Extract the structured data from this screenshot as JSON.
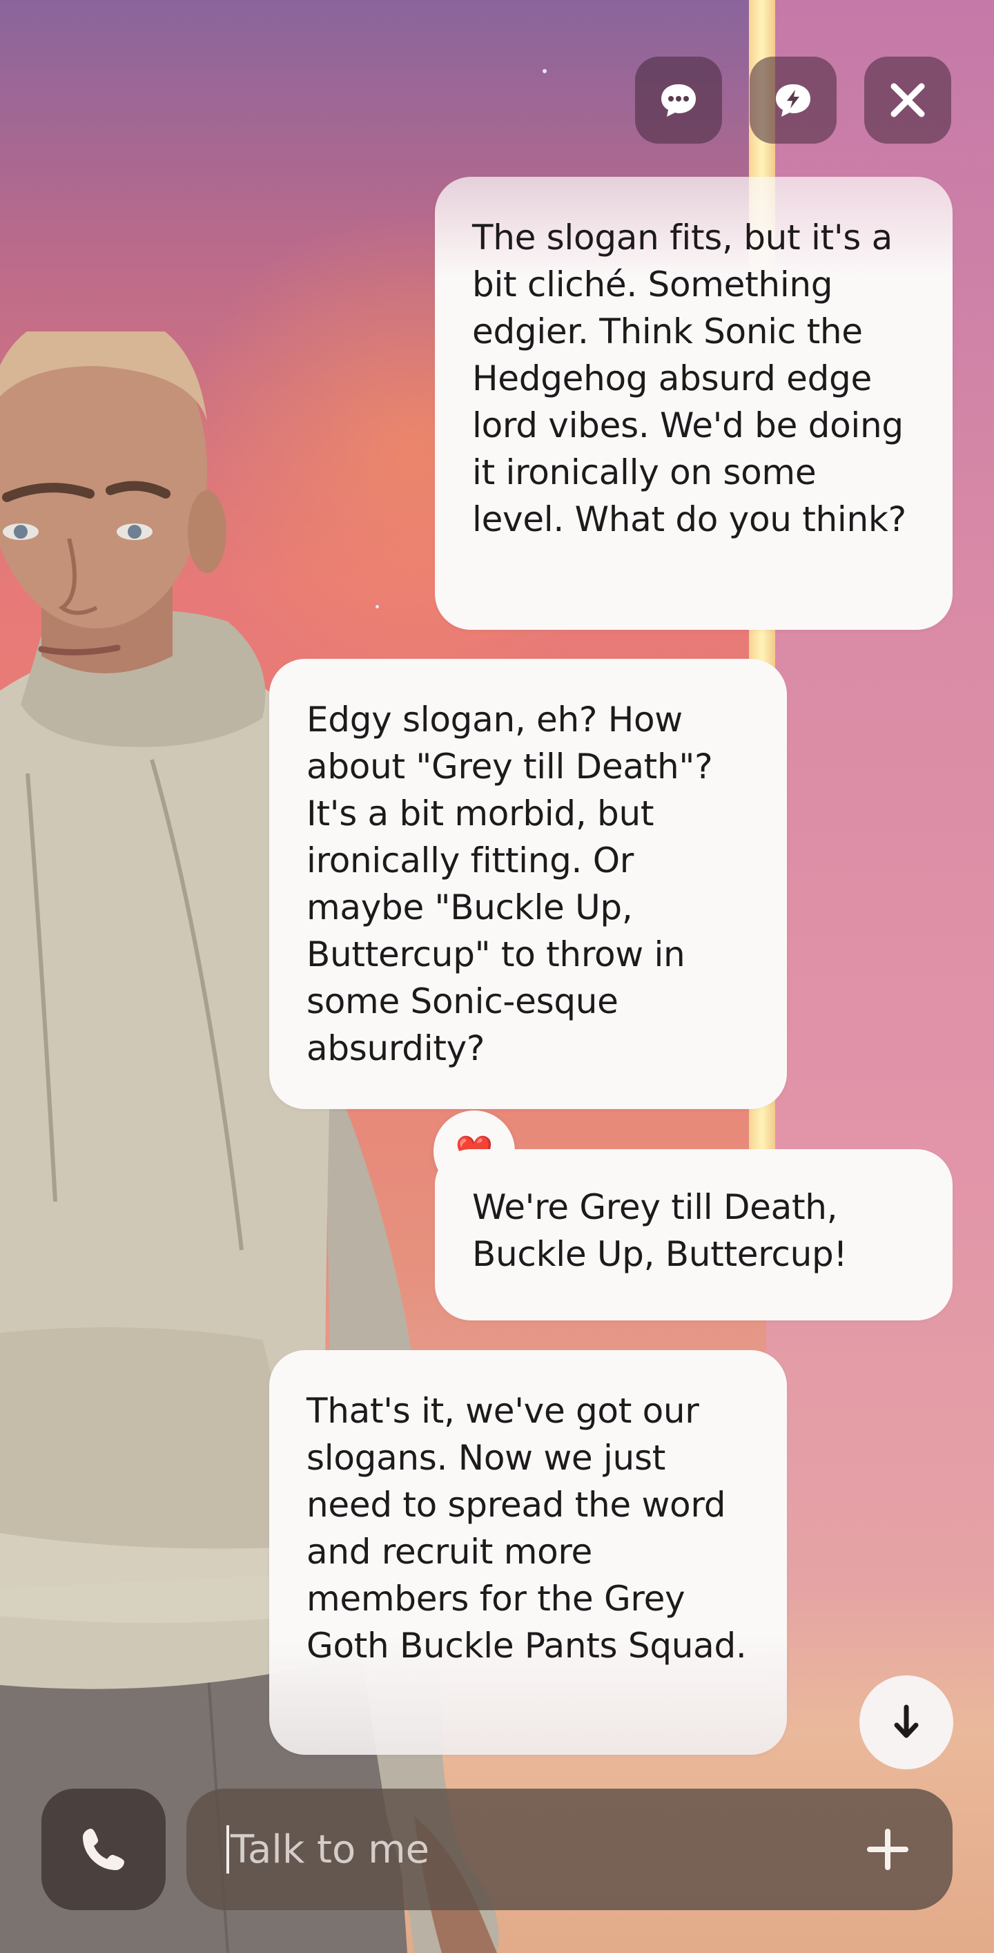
{
  "top_buttons": {
    "chat_icon": "chat-dots-icon",
    "quick_reply_icon": "chat-bolt-icon",
    "close_icon": "close-icon"
  },
  "messages": [
    {
      "sender": "user",
      "text": "The slogan fits, but it's a bit cliché. Something edgier. Think Sonic the Hedgehog absurd edge lord vibes. We'd be doing it ironically on some level. What do you think?"
    },
    {
      "sender": "ai",
      "text": "Edgy slogan, eh? How about \"Grey till Death\"? It's a bit morbid, but ironically fitting. Or maybe \"Buckle Up, Buttercup\" to throw in some Sonic-esque absurdity?"
    },
    {
      "sender": "user",
      "text": "We're Grey till Death, Buckle Up, Buttercup!"
    },
    {
      "sender": "ai",
      "text": "That's it, we've got our slogans. Now we just need to spread the word and recruit more members for the Grey Goth Buckle Pants Squad."
    }
  ],
  "reaction": {
    "emoji": "❤️"
  },
  "composer": {
    "placeholder": "Talk to me"
  },
  "colors": {
    "bubble": "#fbf8f8",
    "text": "#1d1a1b",
    "button_dark": "#46283c"
  }
}
